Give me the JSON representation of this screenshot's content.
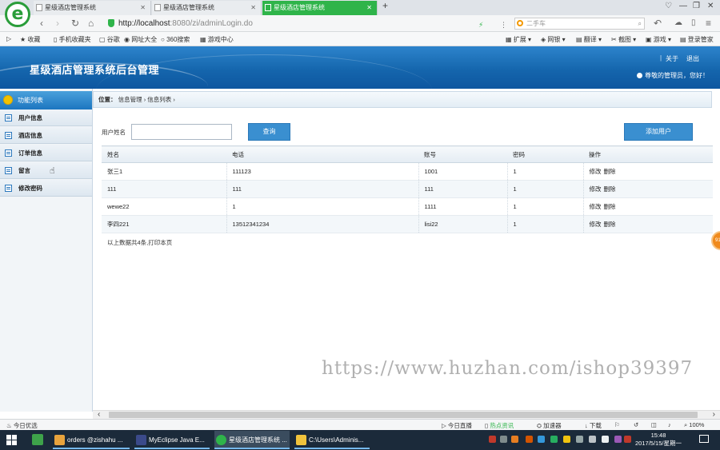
{
  "browser": {
    "tabs": [
      {
        "title": "星级酒店管理系统",
        "active": false
      },
      {
        "title": "星级酒店管理系统",
        "active": false
      },
      {
        "title": "星级酒店管理系统",
        "active": true
      }
    ],
    "new_tab": "+",
    "address": {
      "host": "http://localhost",
      "rest": ":8080/zi/adminLogin.do"
    },
    "search_placeholder": "二手车",
    "bookmarks": [
      "收藏",
      "手机收藏夹",
      "谷歌",
      "网址大全",
      "360搜索",
      "游戏中心"
    ],
    "extensions": [
      "扩展",
      "网银",
      "翻译",
      "截图",
      "游戏",
      "登录管家"
    ]
  },
  "header": {
    "title": "星级酒店管理系统后台管理",
    "about": "关于",
    "logout": "退出",
    "welcome": "尊敬的管理员，您好！"
  },
  "sidebar": {
    "heading": "功能列表",
    "items": [
      {
        "label": "用户信息"
      },
      {
        "label": "酒店信息"
      },
      {
        "label": "订单信息"
      },
      {
        "label": "留言"
      },
      {
        "label": "修改密码"
      }
    ]
  },
  "breadcrumb": {
    "prefix": "位置：",
    "level1": "信息管理",
    "level2": "信息列表",
    "sep": "›"
  },
  "search": {
    "label": "用户姓名",
    "value": "",
    "button": "查询"
  },
  "add_button": "添加用户",
  "table": {
    "headers": [
      "姓名",
      "电话",
      "账号",
      "密码",
      "操作"
    ],
    "rows": [
      {
        "name": "张三1",
        "phone": "111123",
        "account": "1001",
        "password": "1",
        "edit": "修改",
        "delete": "删除"
      },
      {
        "name": "111",
        "phone": "111",
        "account": "111",
        "password": "1",
        "edit": "修改",
        "delete": "删除"
      },
      {
        "name": "wewe22",
        "phone": "1",
        "account": "1111",
        "password": "1",
        "edit": "修改",
        "delete": "删除"
      },
      {
        "name": "李四221",
        "phone": "13512341234",
        "account": "lisi22",
        "password": "1",
        "edit": "修改",
        "delete": "删除"
      }
    ]
  },
  "table_footer": "以上数据共4条,打印本页",
  "watermark": "https://www.huzhan.com/ishop39397",
  "side_float": "91",
  "statusbar": {
    "left": "今日优选",
    "items": [
      "今日直播",
      "热点资讯",
      "加速器",
      "下载",
      "100%"
    ]
  },
  "taskbar": {
    "items": [
      {
        "label": "orders @zishahu ..."
      },
      {
        "label": "MyEclipse Java E..."
      },
      {
        "label": "星级酒店管理系统 ..."
      },
      {
        "label": "C:\\Users\\Adminis..."
      }
    ],
    "time": "15:48",
    "date": "2017/5/15/星期一"
  }
}
